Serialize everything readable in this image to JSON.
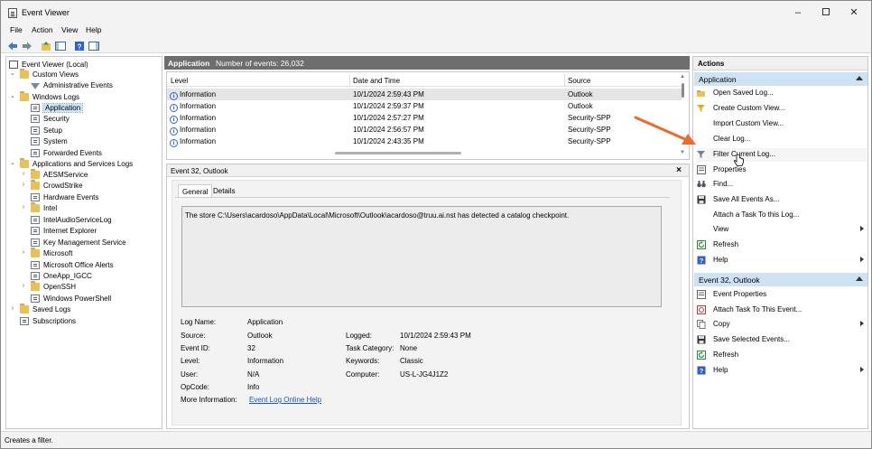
{
  "window": {
    "title": "Event Viewer",
    "minimize": "–",
    "close": "✕"
  },
  "menu": [
    "File",
    "Action",
    "View",
    "Help"
  ],
  "toolbar": {
    "buttons": [
      {
        "name": "back-icon"
      },
      {
        "name": "forward-icon"
      },
      {
        "name": "folder-up-icon"
      },
      {
        "name": "show-hide-tree-icon"
      },
      {
        "name": "help-icon"
      },
      {
        "name": "show-hide-action-pane-icon"
      }
    ]
  },
  "tree": {
    "root": "Event Viewer (Local)",
    "custom_views": "Custom Views",
    "administrative_events": "Administrative Events",
    "windows_logs": "Windows Logs",
    "wl_items": [
      "Application",
      "Security",
      "Setup",
      "System",
      "Forwarded Events"
    ],
    "apps_services": "Applications and Services Logs",
    "as_items": [
      "AESMService",
      "CrowdStrike",
      "Hardware Events",
      "Intel",
      "IntelAudioServiceLog",
      "Internet Explorer",
      "Key Management Service",
      "Microsoft",
      "Microsoft Office Alerts",
      "OneApp_IGCC",
      "OpenSSH",
      "Windows PowerShell"
    ],
    "saved_logs": "Saved Logs",
    "subscriptions": "Subscriptions"
  },
  "center": {
    "log_name": "Application",
    "count_label": "Number of events: 26,032"
  },
  "grid": {
    "columns": [
      "Level",
      "Date and Time",
      "Source"
    ],
    "rows": [
      {
        "level": "Information",
        "date": "10/1/2024 2:59:43 PM",
        "source": "Outlook"
      },
      {
        "level": "Information",
        "date": "10/1/2024 2:59:37 PM",
        "source": "Outlook"
      },
      {
        "level": "Information",
        "date": "10/1/2024 2:57:27 PM",
        "source": "Security-SPP"
      },
      {
        "level": "Information",
        "date": "10/1/2024 2:56:57 PM",
        "source": "Security-SPP"
      },
      {
        "level": "Information",
        "date": "10/1/2024 2:43:35 PM",
        "source": "Security-SPP"
      }
    ]
  },
  "details": {
    "title": "Event 32, Outlook",
    "close": "×",
    "tabs": [
      "General",
      "Details"
    ],
    "message": "The store C:\\Users\\acardoso\\AppData\\Local\\Microsoft\\Outlook\\acardoso@truu.ai.nst has detected a catalog checkpoint.",
    "labels": {
      "log_name": "Log Name:",
      "source": "Source:",
      "event_id": "Event ID:",
      "level": "Level:",
      "user": "User:",
      "opcode": "OpCode:",
      "more_info": "More Information:",
      "logged": "Logged:",
      "task_category": "Task Category:",
      "keywords": "Keywords:",
      "computer": "Computer:"
    },
    "values": {
      "log_name": "Application",
      "source": "Outlook",
      "event_id": "32",
      "level": "Information",
      "user": "N/A",
      "opcode": "Info",
      "more_info": "Event Log Online Help",
      "logged": "10/1/2024 2:59:43 PM",
      "task_category": "None",
      "keywords": "Classic",
      "computer": "US-L-JG4J1Z2"
    }
  },
  "actions": {
    "title": "Actions",
    "section1": "Application",
    "items1": [
      {
        "label": "Open Saved Log...",
        "icon": "open-folder-icon"
      },
      {
        "label": "Create Custom View...",
        "icon": "filter-create-icon"
      },
      {
        "label": "Import Custom View...",
        "icon": ""
      },
      {
        "label": "Clear Log...",
        "icon": ""
      },
      {
        "label": "Filter Current Log...",
        "icon": "filter-icon"
      },
      {
        "label": "Properties",
        "icon": "properties-icon"
      },
      {
        "label": "Find...",
        "icon": "binoculars-icon"
      },
      {
        "label": "Save All Events As...",
        "icon": "save-icon"
      },
      {
        "label": "Attach a Task To this Log...",
        "icon": ""
      },
      {
        "label": "View",
        "icon": ""
      },
      {
        "label": "Refresh",
        "icon": "refresh-icon"
      },
      {
        "label": "Help",
        "icon": "help-icon"
      }
    ],
    "section2": "Event 32, Outlook",
    "items2": [
      {
        "label": "Event Properties",
        "icon": "properties-icon"
      },
      {
        "label": "Attach Task To This Event...",
        "icon": "task-icon"
      },
      {
        "label": "Copy",
        "icon": "copy-icon"
      },
      {
        "label": "Save Selected Events...",
        "icon": "save-icon"
      },
      {
        "label": "Refresh",
        "icon": "refresh-icon"
      },
      {
        "label": "Help",
        "icon": "help-icon"
      }
    ]
  },
  "status": "Creates a filter.",
  "colors": {
    "accent": "#cde3f3",
    "arrow": "#ef6a2a",
    "link": "#1a56c7",
    "header_bg": "#6e6e6e"
  }
}
